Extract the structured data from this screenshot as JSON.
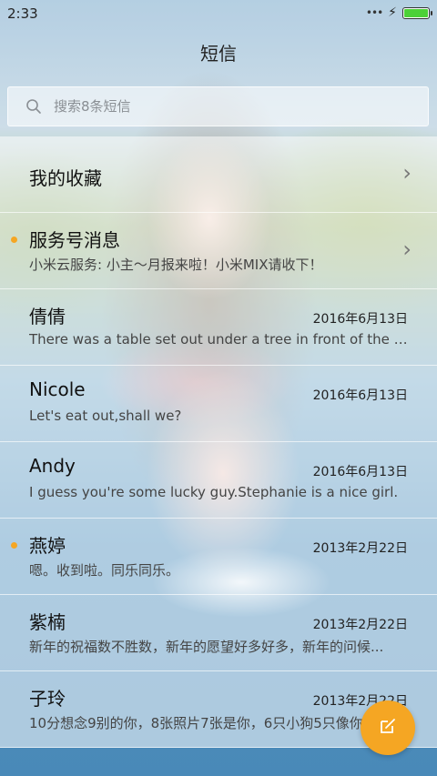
{
  "status_bar": {
    "time": "2:33",
    "battery_level": 1.0
  },
  "app": {
    "title": "短信"
  },
  "search": {
    "placeholder": "搜索8条短信"
  },
  "rows": [
    {
      "name": "我的收藏",
      "preview": "",
      "date": "",
      "unread": false,
      "chevron": true
    },
    {
      "name": "服务号消息",
      "preview": "小米云服务: 小主～月报来啦！小米MIX请收下！",
      "date": "",
      "unread": true,
      "chevron": true
    },
    {
      "name": "倩倩",
      "preview": "There was a table set out under a tree in front of the ho...",
      "date": "2016年6月13日",
      "unread": false,
      "chevron": false
    },
    {
      "name": "Nicole",
      "preview": "Let's eat out,shall we?",
      "date": "2016年6月13日",
      "unread": false,
      "chevron": false
    },
    {
      "name": "Andy",
      "preview": "I guess you're some lucky guy.Stephanie is a nice girl.",
      "date": "2016年6月13日",
      "unread": false,
      "chevron": false
    },
    {
      "name": "燕婷",
      "preview": "嗯。收到啦。同乐同乐。",
      "date": "2013年2月22日",
      "unread": true,
      "chevron": false
    },
    {
      "name": "紫楠",
      "preview": "新年的祝福数不胜数，新年的愿望好多好多，新年的问候...",
      "date": "2013年2月22日",
      "unread": false,
      "chevron": false
    },
    {
      "name": "子玲",
      "preview": "10分想念9别的你，8张照片7张是你，6只小狗5只像你",
      "date": "2013年2月22日",
      "unread": false,
      "chevron": false
    }
  ],
  "icons": {
    "search": "search-icon",
    "chevron": "chevron-right-icon",
    "compose": "compose-icon",
    "bolt": "charging-bolt-icon"
  },
  "colors": {
    "accent": "#f5a623",
    "battery": "#4cd137"
  }
}
